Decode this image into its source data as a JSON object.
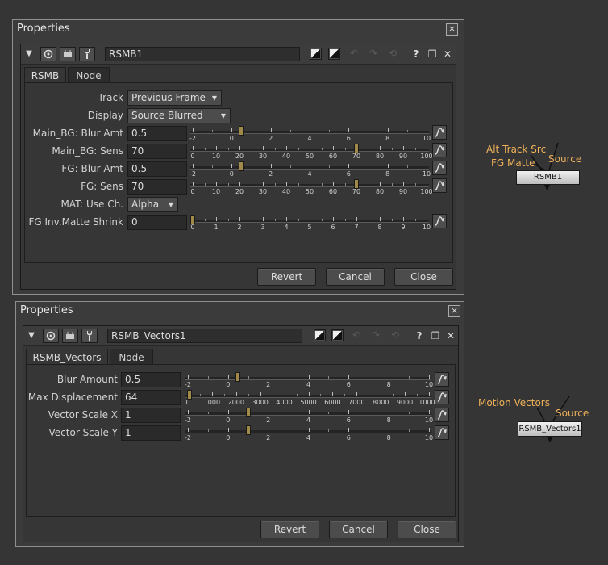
{
  "panel1": {
    "title": "Properties",
    "node_name": "RSMB1",
    "tabs": [
      "RSMB",
      "Node"
    ],
    "track": {
      "label": "Track",
      "value": "Previous Frame"
    },
    "display": {
      "label": "Display",
      "value": "Source Blurred"
    },
    "main_bg_blur": {
      "label": "Main_BG: Blur Amt",
      "value": "0.5",
      "slider_value": 0.5
    },
    "main_bg_sens": {
      "label": "Main_BG: Sens",
      "value": "70",
      "slider_value": 70
    },
    "fg_blur": {
      "label": "FG: Blur Amt",
      "value": "0.5",
      "slider_value": 0.5
    },
    "fg_sens": {
      "label": "FG: Sens",
      "value": "70",
      "slider_value": 70
    },
    "mat_use": {
      "label": "MAT: Use Ch.",
      "value": "Alpha"
    },
    "fg_shrink": {
      "label": "FG Inv.Matte Shrink",
      "value": "0",
      "slider_value": 0
    },
    "scale_blur": [
      "-2",
      "0",
      "2",
      "4",
      "6",
      "8",
      "10"
    ],
    "scale_sens": [
      "0",
      "10",
      "20",
      "30",
      "40",
      "50",
      "60",
      "70",
      "80",
      "90",
      "100"
    ],
    "scale_shrink": [
      "0",
      "1",
      "2",
      "3",
      "4",
      "5",
      "6",
      "7",
      "8",
      "9",
      "10"
    ],
    "buttons": {
      "revert": "Revert",
      "cancel": "Cancel",
      "close": "Close"
    }
  },
  "panel2": {
    "title": "Properties",
    "node_name": "RSMB_Vectors1",
    "tabs": [
      "RSMB_Vectors",
      "Node"
    ],
    "blur_amount": {
      "label": "Blur Amount",
      "value": "0.5",
      "slider_value": 0.5
    },
    "max_disp": {
      "label": "Max Displacement",
      "value": "64",
      "slider_value": 64
    },
    "scale_x": {
      "label": "Vector Scale X",
      "value": "1",
      "slider_value": 1
    },
    "scale_y": {
      "label": "Vector Scale Y",
      "value": "1",
      "slider_value": 1
    },
    "scale_blur": [
      "-2",
      "0",
      "2",
      "4",
      "6",
      "8",
      "10"
    ],
    "scale_disp": [
      "0",
      "1000",
      "2000",
      "3000",
      "4000",
      "5000",
      "6000",
      "7000",
      "8000",
      "9000",
      "10000"
    ],
    "buttons": {
      "revert": "Revert",
      "cancel": "Cancel",
      "close": "Close"
    }
  },
  "graph": {
    "node1": {
      "name": "RSMB1",
      "inputs": [
        "Alt Track Src",
        "FG Matte",
        "Source"
      ]
    },
    "node2": {
      "name": "RSMB_Vectors1",
      "inputs": [
        "Motion Vectors",
        "Source"
      ]
    },
    "accent_color": "#f0b25a"
  }
}
